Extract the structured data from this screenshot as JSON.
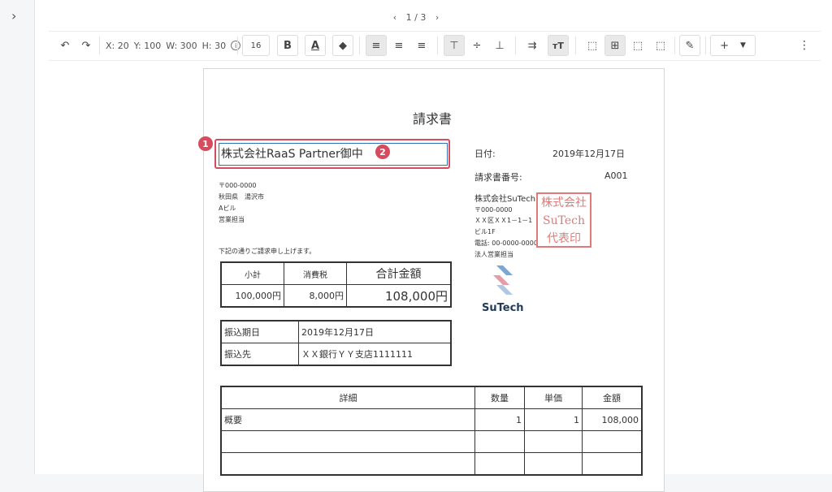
{
  "sidebar": {
    "toggle_icon": "chevron-right-icon"
  },
  "pager": {
    "prev": "‹",
    "label": "1 / 3",
    "next": "›"
  },
  "toolbar": {
    "x_label": "X: 20",
    "y_label": "Y: 100",
    "w_label": "W: 300",
    "h_label": "H: 30",
    "font_size": "16",
    "bold": "B",
    "font_color": "A",
    "add": "+"
  },
  "invoice": {
    "title": "請求書",
    "recipient": "株式会社RaaS Partner御中",
    "recipient_address": [
      "〒000-0000",
      "秋田県　湯沢市",
      "Aビル",
      "営業担当"
    ],
    "notice": "下記の通りご請求申し上げます。",
    "date_label": "日付:",
    "date_value": "2019年12月17日",
    "number_label": "請求書番号:",
    "number_value": "A001",
    "issuer": [
      "株式会社SuTech",
      "〒000-0000",
      "ＸＸ区ＸＸ1－1－1",
      "ビル1F",
      "電話: 00-0000-0000",
      "法人営業担当"
    ],
    "stamp_lines": [
      "株式会社",
      "SuTech",
      "代表印"
    ],
    "logo_text": "SuTech",
    "summary": {
      "headers": [
        "小計",
        "消費税",
        "合計金額"
      ],
      "values": [
        "100,000円",
        "8,000円",
        "108,000円"
      ]
    },
    "payment": {
      "rows": [
        {
          "label": "振込期日",
          "value": "2019年12月17日"
        },
        {
          "label": "振込先",
          "value": "ＸＸ銀行ＹＹ支店1111111"
        }
      ]
    },
    "details": {
      "headers": [
        "詳細",
        "数量",
        "単価",
        "金額"
      ],
      "rows": [
        [
          "概要",
          "1",
          "1",
          "108,000"
        ]
      ]
    }
  },
  "callouts": [
    "1",
    "2"
  ],
  "colors": {
    "selection": "#2f6fb5",
    "highlight": "#d64b5d",
    "stamp": "#e07a7a"
  }
}
